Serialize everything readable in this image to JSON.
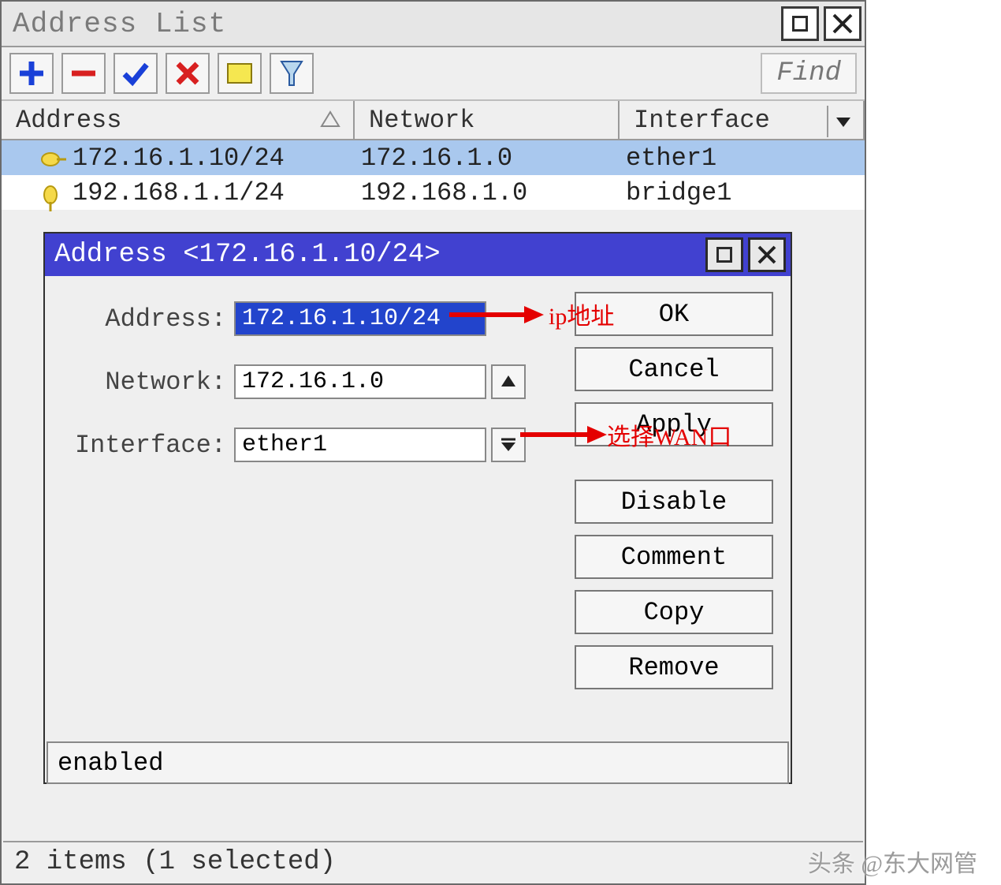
{
  "main_window": {
    "title": "Address List",
    "find_label": "Find",
    "columns": {
      "address": "Address",
      "network": "Network",
      "interface": "Interface"
    },
    "rows": [
      {
        "address": "172.16.1.10/24",
        "network": "172.16.1.0",
        "interface": "ether1",
        "selected": true
      },
      {
        "address": "192.168.1.1/24",
        "network": "192.168.1.0",
        "interface": "bridge1",
        "selected": false
      }
    ],
    "status": "2 items (1 selected)"
  },
  "dialog": {
    "title": "Address <172.16.1.10/24>",
    "fields": {
      "address_label": "Address:",
      "address_value": "172.16.1.10/24",
      "network_label": "Network:",
      "network_value": "172.16.1.0",
      "interface_label": "Interface:",
      "interface_value": "ether1"
    },
    "buttons": {
      "ok": "OK",
      "cancel": "Cancel",
      "apply": "Apply",
      "disable": "Disable",
      "comment": "Comment",
      "copy": "Copy",
      "remove": "Remove"
    },
    "status": "enabled"
  },
  "annotations": {
    "ip_label": "ip地址",
    "wan_label": "选择WAN口"
  },
  "watermark": "头条 @东大网管"
}
